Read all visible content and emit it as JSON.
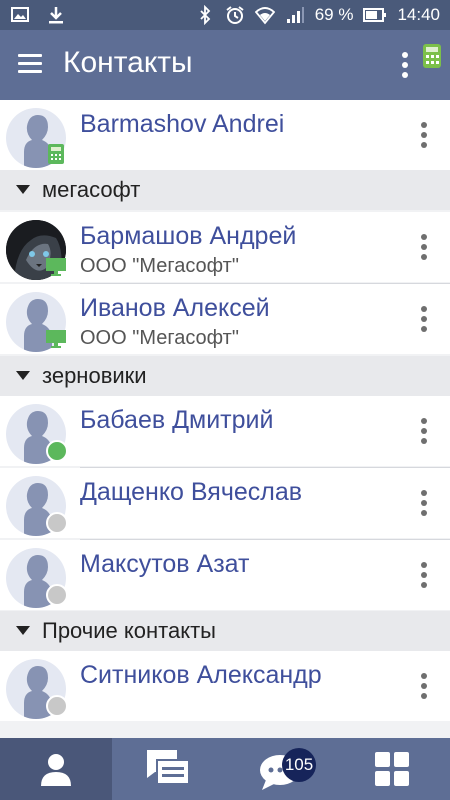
{
  "status_bar": {
    "battery_percent": "69 %",
    "time": "14:40",
    "icons": [
      "image-icon",
      "download-icon",
      "bluetooth-icon",
      "alarm-icon",
      "wifi-icon",
      "signal-icon",
      "battery-icon"
    ]
  },
  "app_bar": {
    "title": "Контакты",
    "icons": [
      "hamburger-menu-icon",
      "more-vertical-icon",
      "calculator-icon"
    ]
  },
  "colors": {
    "primary": "#5e6e95",
    "status_bar": "#4a5a7a",
    "name_text": "#3f4f9c",
    "online_green": "#5cb85c",
    "offline_gray": "#c8c8c8",
    "badge_bg": "#16245a"
  },
  "contacts_top": [
    {
      "name": "Barmashov Andrei",
      "company": "",
      "status": "mobile"
    }
  ],
  "groups": [
    {
      "label": "мегасофт",
      "contacts": [
        {
          "name": "Бармашов Андрей",
          "company": "ООО \"Мегасофт\"",
          "status": "desktop"
        },
        {
          "name": "Иванов Алексей",
          "company": "ООО \"Мегасофт\"",
          "status": "desktop"
        }
      ]
    },
    {
      "label": "зерновики",
      "contacts": [
        {
          "name": "Бабаев Дмитрий",
          "company": "",
          "status": "online"
        },
        {
          "name": "Дащенко Вячеслав",
          "company": "",
          "status": "offline"
        },
        {
          "name": "Максутов Азат",
          "company": "",
          "status": "offline"
        }
      ]
    },
    {
      "label": "Прочие контакты",
      "contacts": [
        {
          "name": "Ситников Александр",
          "company": "",
          "status": "offline"
        }
      ]
    }
  ],
  "tab_bar": {
    "tabs": [
      "contacts-tab",
      "messages-tab",
      "chats-tab",
      "apps-tab"
    ],
    "active": "contacts-tab",
    "chats_badge": "105"
  }
}
